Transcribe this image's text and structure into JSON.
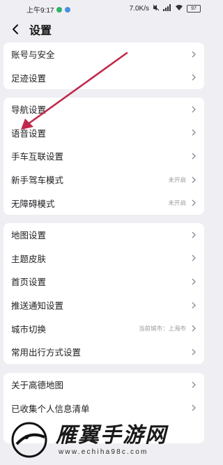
{
  "status_bar": {
    "time": "上午9:17",
    "speed": "7.0K/s",
    "battery": "97"
  },
  "header": {
    "title": "设置"
  },
  "groups": [
    {
      "items": [
        {
          "label": "账号与安全",
          "value": ""
        },
        {
          "label": "足迹设置",
          "value": ""
        }
      ]
    },
    {
      "items": [
        {
          "label": "导航设置",
          "value": ""
        },
        {
          "label": "语音设置",
          "value": ""
        },
        {
          "label": "手车互联设置",
          "value": ""
        },
        {
          "label": "新手驾车模式",
          "value": "未开启"
        },
        {
          "label": "无障碍模式",
          "value": "未开启"
        }
      ]
    },
    {
      "items": [
        {
          "label": "地图设置",
          "value": ""
        },
        {
          "label": "主题皮肤",
          "value": ""
        },
        {
          "label": "首页设置",
          "value": ""
        },
        {
          "label": "推送通知设置",
          "value": ""
        },
        {
          "label": "城市切换",
          "value": "当前城市：上海市"
        },
        {
          "label": "常用出行方式设置",
          "value": ""
        }
      ]
    },
    {
      "items": [
        {
          "label": "关于高德地图",
          "value": ""
        },
        {
          "label": "已收集个人信息清单",
          "value": ""
        }
      ]
    }
  ],
  "watermark": {
    "title": "雁翼手游网",
    "url": "www.echiha98c.com"
  },
  "colors": {
    "background": "#efeff3",
    "card": "#ffffff",
    "arrow": "#c0284a"
  }
}
